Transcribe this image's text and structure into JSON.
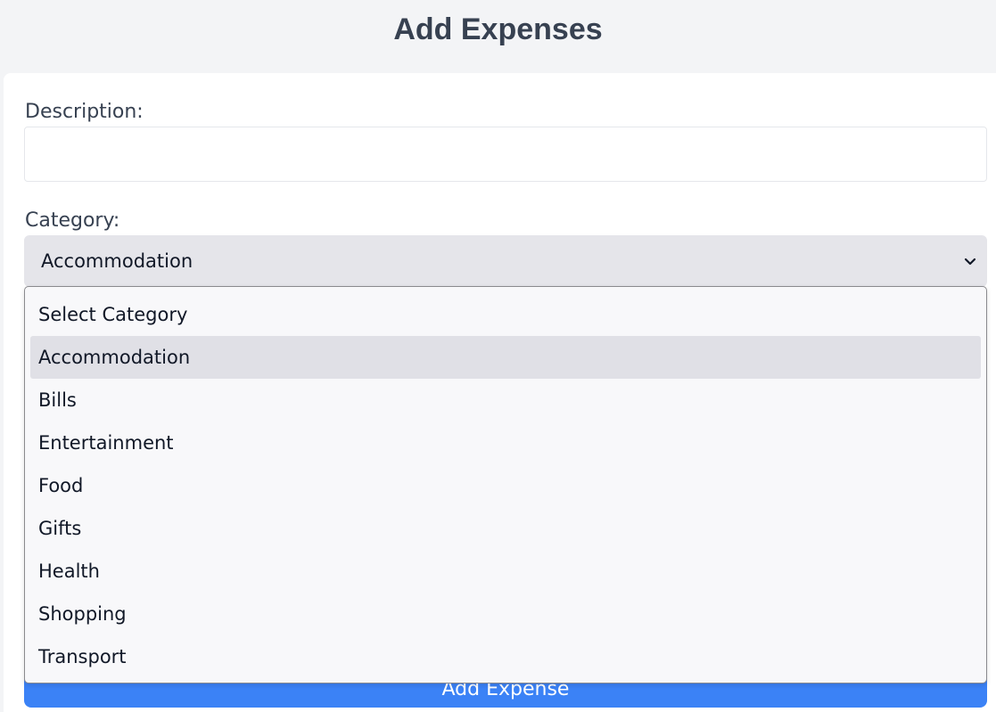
{
  "header": {
    "title": "Add Expenses"
  },
  "form": {
    "description_label": "Description:",
    "description_value": "",
    "category_label": "Category:",
    "category_selected": "Accommodation",
    "submit_label": "Add Expense"
  },
  "dropdown": {
    "options": [
      {
        "label": "Select Category"
      },
      {
        "label": "Accommodation",
        "selected": true
      },
      {
        "label": "Bills"
      },
      {
        "label": "Entertainment"
      },
      {
        "label": "Food"
      },
      {
        "label": "Gifts"
      },
      {
        "label": "Health"
      },
      {
        "label": "Shopping"
      },
      {
        "label": "Transport"
      }
    ]
  },
  "colors": {
    "page_bg": "#f3f4f6",
    "card_bg": "#ffffff",
    "button_bg": "#3b82f6",
    "select_bg": "#e5e5ea",
    "option_highlight": "#e0e0e6"
  },
  "icons": {
    "select_arrow": "chevron-down-icon"
  }
}
